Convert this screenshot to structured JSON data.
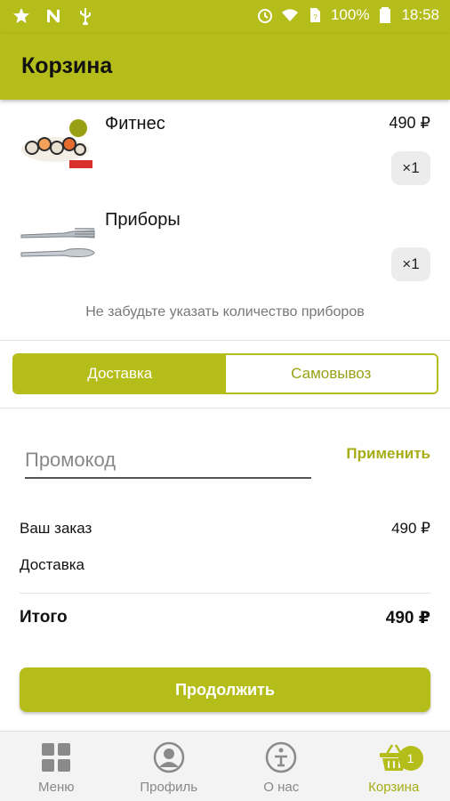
{
  "status_bar": {
    "battery": "100%",
    "time": "18:58",
    "icons": [
      "star-icon",
      "n-icon",
      "usb-icon",
      "alarm-icon",
      "wifi-icon",
      "sim-icon",
      "battery-icon"
    ]
  },
  "header": {
    "title": "Корзина"
  },
  "cart": {
    "items": [
      {
        "name": "Фитнес",
        "price": "490 ₽",
        "qty": "×1",
        "thumb": "sushi-set-image"
      },
      {
        "name": "Приборы",
        "price": "",
        "qty": "×1",
        "thumb": "cutlery-image"
      }
    ],
    "hint": "Не забудьте указать количество приборов"
  },
  "delivery_toggle": {
    "options": [
      {
        "label": "Доставка",
        "active": true
      },
      {
        "label": "Самовывоз",
        "active": false
      }
    ]
  },
  "promo": {
    "placeholder": "Промокод",
    "value": "",
    "apply_label": "Применить"
  },
  "summary": {
    "order_label": "Ваш заказ",
    "order_value": "490 ₽",
    "delivery_label": "Доставка",
    "delivery_value": "",
    "total_label": "Итого",
    "total_value": "490 ₽"
  },
  "continue_label": "Продолжить",
  "bottom_nav": {
    "items": [
      {
        "label": "Меню",
        "icon": "grid-icon",
        "active": false
      },
      {
        "label": "Профиль",
        "icon": "profile-icon",
        "active": false
      },
      {
        "label": "О нас",
        "icon": "info-icon",
        "active": false
      },
      {
        "label": "Корзина",
        "icon": "basket-icon",
        "active": true,
        "badge": "1"
      }
    ]
  },
  "colors": {
    "accent": "#b5bd1a",
    "accent_text": "#a6ad14"
  }
}
